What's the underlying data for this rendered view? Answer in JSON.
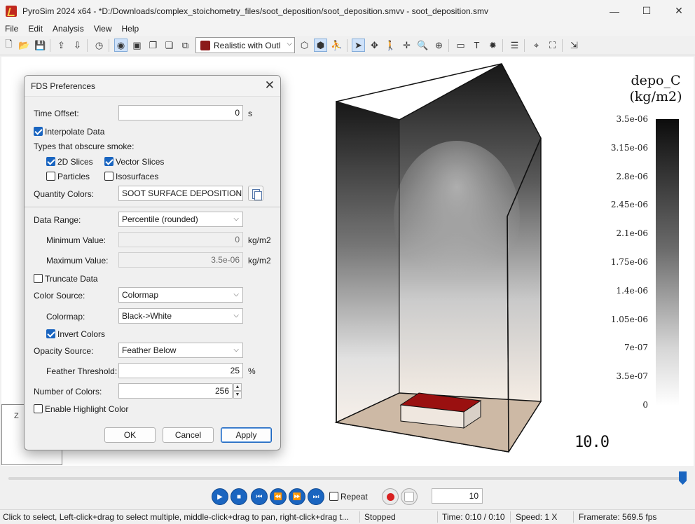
{
  "window": {
    "title": "PyroSim 2024 x64 - *D:/Downloads/complex_stoichometry_files/soot_deposition/soot_deposition.smvv - soot_deposition.smv",
    "minimize_glyph": "—",
    "maximize_glyph": "☐",
    "close_glyph": "✕"
  },
  "menu": [
    "File",
    "Edit",
    "Analysis",
    "View",
    "Help"
  ],
  "toolbar": {
    "render_mode": "Realistic with Outl"
  },
  "viewport": {
    "axis_label": "Z",
    "time_readout": "10.0",
    "colorbar": {
      "title_line1": "depo_C",
      "title_line2": "(kg/m2)",
      "ticks": [
        "3.5e-06",
        "3.15e-06",
        "2.8e-06",
        "2.45e-06",
        "2.1e-06",
        "1.75e-06",
        "1.4e-06",
        "1.05e-06",
        "7e-07",
        "3.5e-07",
        "0"
      ],
      "top_color": "#0c0c0c",
      "bottom_color": "#ffffff"
    }
  },
  "dialog": {
    "title": "FDS Preferences",
    "time_offset_label": "Time Offset:",
    "time_offset_value": "0",
    "time_offset_unit": "s",
    "interpolate_label": "Interpolate Data",
    "interpolate_checked": true,
    "obscure_label": "Types that obscure smoke:",
    "slices_2d_label": "2D Slices",
    "vector_slices_label": "Vector Slices",
    "particles_label": "Particles",
    "isosurfaces_label": "Isosurfaces",
    "quantity_colors_label": "Quantity Colors:",
    "quantity_colors_value": "SOOT SURFACE DEPOSITION",
    "data_range_label": "Data Range:",
    "data_range_value": "Percentile (rounded)",
    "min_label": "Minimum Value:",
    "min_value": "0",
    "min_unit": "kg/m2",
    "max_label": "Maximum Value:",
    "max_value": "3.5e-06",
    "max_unit": "kg/m2",
    "truncate_label": "Truncate Data",
    "color_source_label": "Color Source:",
    "color_source_value": "Colormap",
    "colormap_label": "Colormap:",
    "colormap_value": "Black->White",
    "invert_label": "Invert Colors",
    "opacity_label": "Opacity Source:",
    "opacity_value": "Feather Below",
    "feather_label": "Feather Threshold:",
    "feather_value": "25",
    "feather_unit": "%",
    "num_colors_label": "Number of Colors:",
    "num_colors_value": "256",
    "highlight_label": "Enable Highlight Color",
    "ok_label": "OK",
    "cancel_label": "Cancel",
    "apply_label": "Apply"
  },
  "playback": {
    "repeat_label": "Repeat",
    "frame_value": "10",
    "progress_fraction": 1.0
  },
  "status": {
    "hint": "Click to select, Left-click+drag to select multiple, middle-click+drag to pan, right-click+drag t...",
    "state": "Stopped",
    "time": "Time: 0:10 / 0:10",
    "speed": "Speed: 1 X",
    "framerate": "Framerate: 569.5 fps"
  }
}
